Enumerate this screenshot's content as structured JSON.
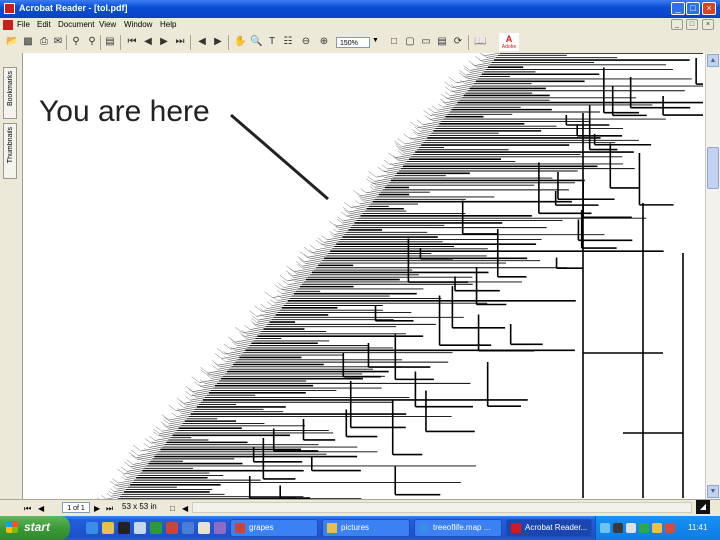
{
  "window": {
    "title": "Acrobat Reader - [tol.pdf]",
    "minimize": "_",
    "maximize": "□",
    "close": "×"
  },
  "menu": [
    "File",
    "Edit",
    "Document",
    "View",
    "Window",
    "Help"
  ],
  "toolbar": {
    "zoom_value": "150%",
    "adobe_logo": "A",
    "adobe_word": "Adobe"
  },
  "nav_tabs": [
    "Bookmarks",
    "Thumbnails"
  ],
  "document": {
    "annotation": "You are here"
  },
  "status": {
    "page": "1 of 1",
    "page_size": "53 x 53 in"
  },
  "taskbar": {
    "start_label": "start",
    "tasks": [
      {
        "label": "grapes",
        "active": false
      },
      {
        "label": "pictures",
        "active": false
      },
      {
        "label": "treeoflife.map ...",
        "active": false
      },
      {
        "label": "Acrobat Reader...",
        "active": true
      }
    ],
    "clock": "11:41"
  },
  "colors": {
    "titlebar": "#0a4fd6",
    "taskbar": "#245edc",
    "start": "#3b9a37",
    "acrobat_red": "#d21a1a"
  }
}
